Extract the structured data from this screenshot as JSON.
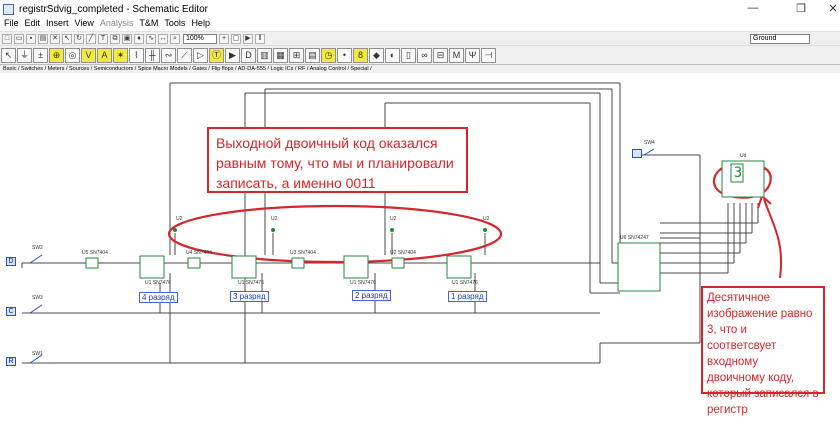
{
  "window": {
    "title": "registrSdvig_completed - Schematic Editor",
    "minimize": "—",
    "restore": "❐",
    "close": "✕"
  },
  "menu": [
    "File",
    "Edit",
    "Insert",
    "View",
    "Analysis",
    "T&M",
    "Tools",
    "Help"
  ],
  "toolbar": {
    "zoom": "100%",
    "component_value": "Ground"
  },
  "component_tabs": "Basic / Switches / Meters / Sources / Semiconductors / Spice Macro Models / Gates / Flip flops / AD-DA-555 / Logic ICs / RF / Analog Control / Special /",
  "switches": [
    {
      "key": "D",
      "name": "SW2"
    },
    {
      "key": "C",
      "name": "SW3"
    },
    {
      "key": "R",
      "name": "SW1"
    }
  ],
  "inverters": [
    {
      "name": "U5 SN7404"
    },
    {
      "name": "U4 SN7404"
    },
    {
      "name": "U3 SN7404"
    },
    {
      "name": "U2 SN7404"
    }
  ],
  "flipflops": [
    {
      "name": "U1 SN7476",
      "bit": "4 разряд"
    },
    {
      "name": "U1 SN7476",
      "bit": "3 разряд"
    },
    {
      "name": "U1 SN7476",
      "bit": "2 разряд"
    },
    {
      "name": "U1 SN7476",
      "bit": "1 разряд"
    }
  ],
  "probes": [
    "U2",
    "U2",
    "U2",
    "U2"
  ],
  "decoder": {
    "name": "U6 SN74247"
  },
  "display": {
    "value": "3",
    "name": "Ud"
  },
  "sw4": {
    "name": "SW4"
  },
  "annotations": {
    "top": "Выходной двоичный код оказался равным тому, что мы и планировали записать, а именно 0011",
    "right": "Десятичное изображение равно 3, что и соответсвует входному двоичному коду, который записался в регистр"
  },
  "colors": {
    "annotation": "#d6262b",
    "wire": "#4a4a4a",
    "bus": "#8b2a2a",
    "component": "#1f8a3c",
    "switch": "#2850d8"
  }
}
